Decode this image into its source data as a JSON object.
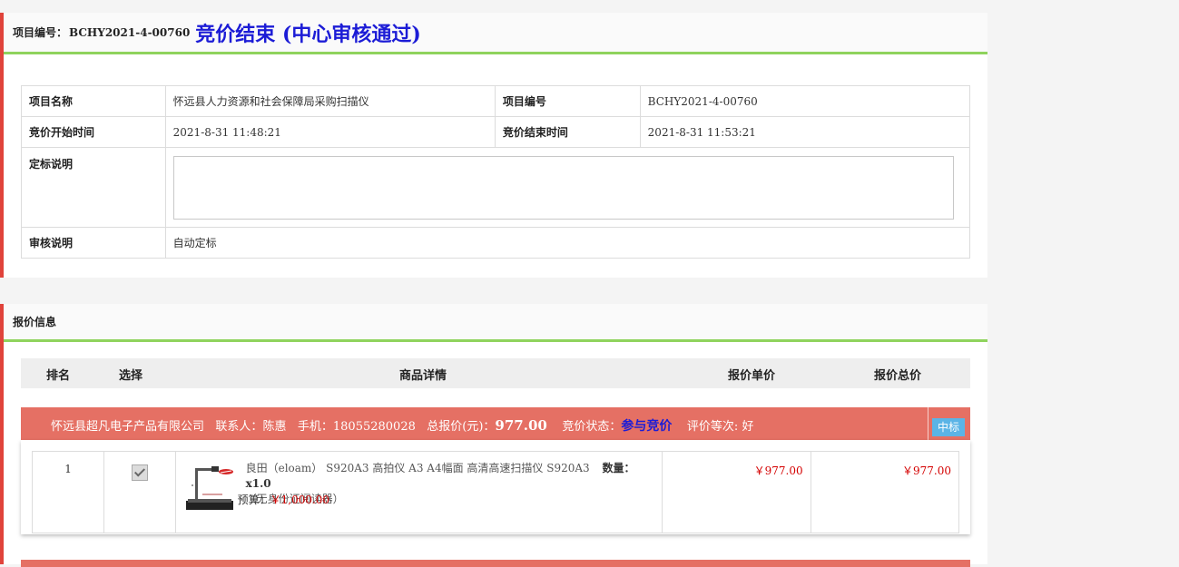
{
  "header": {
    "code_label": "项目编号：",
    "code_value": "BCHY2021-4-00760",
    "status_title": "竞价结束 (中心审核通过)"
  },
  "info": {
    "name_label": "项目名称",
    "name_value": "怀远县人力资源和社会保障局采购扫描仪",
    "code_label": "项目编号",
    "code_value": "BCHY2021-4-00760",
    "start_label": "竞价开始时间",
    "start_value": "2021-8-31 11:48:21",
    "end_label": "竞价结束时间",
    "end_value": "2021-8-31 11:53:21",
    "award_label": "定标说明",
    "award_value": "",
    "review_label": "审核说明",
    "review_value": "自动定标"
  },
  "quotes": {
    "section_title": "报价信息",
    "columns": {
      "rank": "排名",
      "select": "选择",
      "detail": "商品详情",
      "unit_price": "报价单价",
      "total_price": "报价总价"
    },
    "supplier": {
      "company": "怀远县超凡电子产品有限公司",
      "contact_label": "联系人：",
      "contact": "陈惠",
      "phone_label": "手机：",
      "phone": "18055280028",
      "total_label": "总报价(元)：",
      "total": "977.00",
      "status_label": "竞价状态：",
      "status": "参与竞价",
      "rating_label": "评价等次:",
      "rating": "好",
      "badge": "中标"
    },
    "item": {
      "rank": "1",
      "checked": true,
      "product_name": "良田（eloam） S920A3 高拍仪 A3 A4幅面 高清高速扫描仪 S920A3",
      "product_sub": "（无身份证阅读器）",
      "qty_label": "数量：",
      "qty": "x1.0",
      "budget_label": "预算：",
      "budget": "￥1,000.00",
      "unit_price": "￥977.00",
      "total_price": "￥977.00"
    }
  },
  "colors": {
    "accent_red": "#e0433b",
    "accent_green": "#8fd35d",
    "supplier_bar": "#e57064",
    "status_blue": "#1c1cd6",
    "price_red": "#d40000",
    "badge_blue": "#5bb4e6"
  }
}
